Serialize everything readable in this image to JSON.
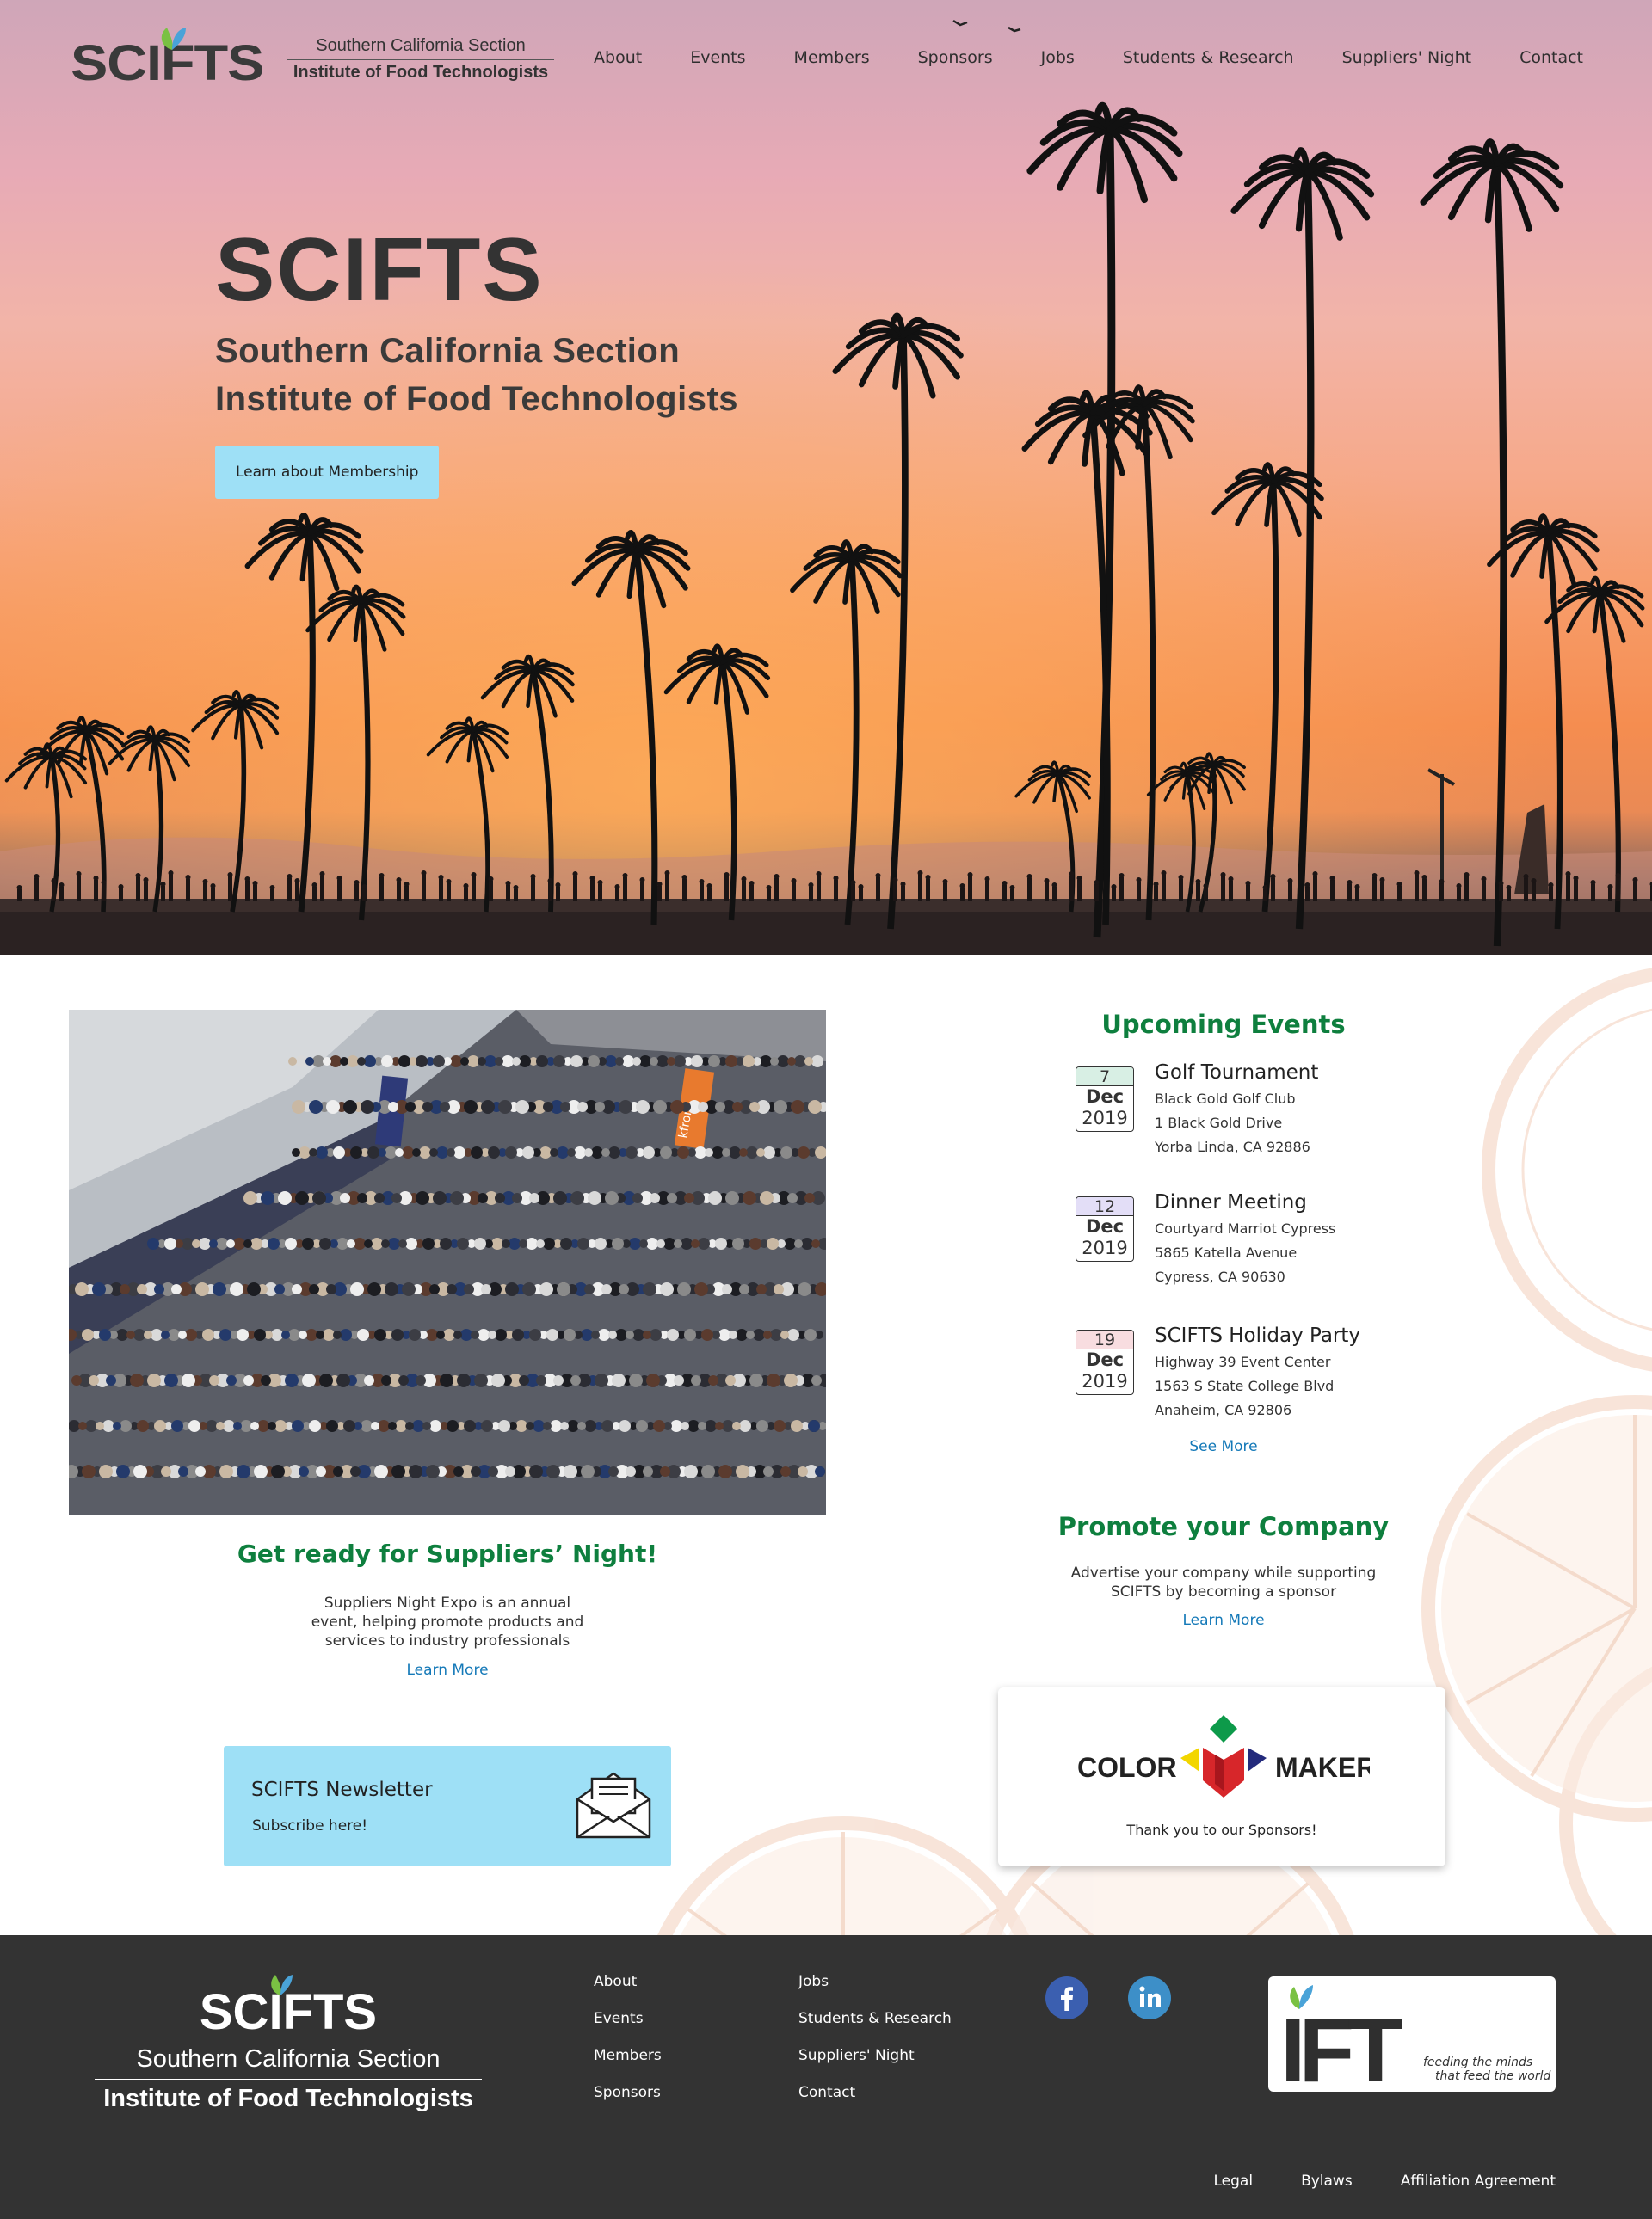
{
  "header": {
    "logo_mark": "SCIFTS",
    "logo_line1": "Southern California Section",
    "logo_line2": "Institute of Food Technologists",
    "nav": [
      "About",
      "Events",
      "Members",
      "Sponsors",
      "Jobs",
      "Students & Research",
      "Suppliers' Night",
      "Contact"
    ]
  },
  "hero": {
    "title": "SCIFTS",
    "subtitle_line1": "Southern California Section",
    "subtitle_line2": "Institute of Food Technologists",
    "cta_label": "Learn about Membership"
  },
  "suppliers_night": {
    "title": "Get ready for Suppliers’ Night!",
    "description": "Suppliers Night Expo is an annual event, helping promote products and services to industry professionals",
    "link_label": "Learn More",
    "banner_text": "kfront"
  },
  "newsletter": {
    "title": "SCIFTS Newsletter",
    "subtitle": "Subscribe here!"
  },
  "upcoming_events": {
    "title": "Upcoming Events",
    "events": [
      {
        "day": "7",
        "month": "Dec",
        "year": "2019",
        "name": "Golf Tournament",
        "line1": "Black Gold Golf Club",
        "line2": "1 Black Gold Drive",
        "line3": "Yorba Linda, CA 92886",
        "cal_color": "#d8efe4"
      },
      {
        "day": "12",
        "month": "Dec",
        "year": "2019",
        "name": "Dinner Meeting",
        "line1": "Courtyard Marriot Cypress",
        "line2": "5865 Katella Avenue",
        "line3": "Cypress, CA 90630",
        "cal_color": "#e3def7"
      },
      {
        "day": "19",
        "month": "Dec",
        "year": "2019",
        "name": "SCIFTS Holiday Party",
        "line1": "Highway 39 Event Center",
        "line2": "1563 S State College Blvd",
        "line3": "Anaheim, CA 92806",
        "cal_color": "#f8dde0"
      }
    ],
    "see_more_label": "See More"
  },
  "promote": {
    "title": "Promote your Company",
    "description": "Advertise your company while supporting SCIFTS by becoming a sponsor",
    "link_label": "Learn More"
  },
  "sponsor": {
    "logo_left": "COLOR",
    "logo_right": "MAKER",
    "thanks": "Thank you to our Sponsors!"
  },
  "footer": {
    "logo_mark": "SCIFTS",
    "logo_line1": "Southern California Section",
    "logo_line2": "Institute of Food Technologists",
    "col1": [
      "About",
      "Events",
      "Members",
      "Sponsors"
    ],
    "col2": [
      "Jobs",
      "Students & Research",
      "Suppliers' Night",
      "Contact"
    ],
    "social": [
      "facebook-icon",
      "linkedin-icon"
    ],
    "ift_logo_text": "IFT",
    "ift_tagline1": "feeding the minds",
    "ift_tagline2": "that feed the world",
    "legal": [
      "Legal",
      "Bylaws",
      "Affiliation Agreement"
    ]
  },
  "colors": {
    "accent_green": "#0e7f3e",
    "link_blue": "#1479b8",
    "cta_blue": "#9ee0f6",
    "footer_bg": "#333333"
  }
}
